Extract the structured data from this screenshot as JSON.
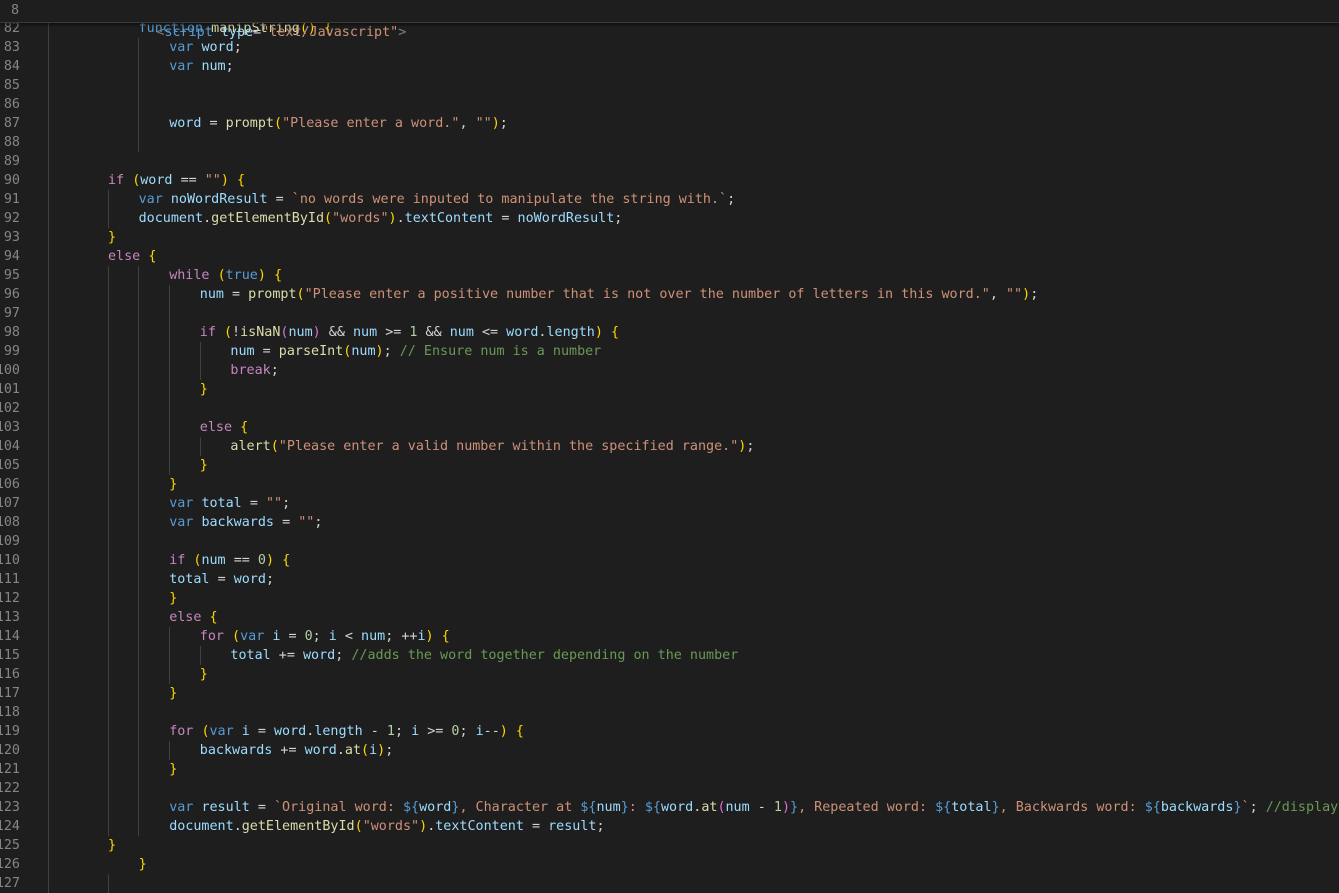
{
  "sticky": {
    "line_number": "8",
    "text": "<script type=\"text/Javascript\">"
  },
  "lines": [
    {
      "n": "82",
      "text": "    function manipString() {"
    },
    {
      "n": "83",
      "text": "        var word;"
    },
    {
      "n": "84",
      "text": "        var num;"
    },
    {
      "n": "85",
      "text": ""
    },
    {
      "n": "86",
      "text": ""
    },
    {
      "n": "87",
      "text": "        word = prompt(\"Please enter a word.\", \"\");"
    },
    {
      "n": "88",
      "text": ""
    },
    {
      "n": "89",
      "text": ""
    },
    {
      "n": "90",
      "text": "if (word == \"\") {"
    },
    {
      "n": "91",
      "text": "    var noWordResult = `no words were inputed to manipulate the string with.`;"
    },
    {
      "n": "92",
      "text": "    document.getElementById(\"words\").textContent = noWordResult;"
    },
    {
      "n": "93",
      "text": "}"
    },
    {
      "n": "94",
      "text": "else {"
    },
    {
      "n": "95",
      "text": "        while (true) {"
    },
    {
      "n": "96",
      "text": "            num = prompt(\"Please enter a positive number that is not over the number of letters in this word.\", \"\");"
    },
    {
      "n": "97",
      "text": ""
    },
    {
      "n": "98",
      "text": "            if (!isNaN(num) && num >= 1 && num <= word.length) {"
    },
    {
      "n": "99",
      "text": "                num = parseInt(num); // Ensure num is a number"
    },
    {
      "n": "100",
      "text": "                break;"
    },
    {
      "n": "101",
      "text": "            }"
    },
    {
      "n": "102",
      "text": ""
    },
    {
      "n": "103",
      "text": "            else {"
    },
    {
      "n": "104",
      "text": "                alert(\"Please enter a valid number within the specified range.\");"
    },
    {
      "n": "105",
      "text": "            }"
    },
    {
      "n": "106",
      "text": "        }"
    },
    {
      "n": "107",
      "text": "        var total = \"\";"
    },
    {
      "n": "108",
      "text": "        var backwards = \"\";"
    },
    {
      "n": "109",
      "text": ""
    },
    {
      "n": "110",
      "text": "        if (num == 0) {"
    },
    {
      "n": "111",
      "text": "        total = word;"
    },
    {
      "n": "112",
      "text": "        }"
    },
    {
      "n": "113",
      "text": "        else {"
    },
    {
      "n": "114",
      "text": "            for (var i = 0; i < num; ++i) {"
    },
    {
      "n": "115",
      "text": "                total += word; //adds the word together depending on the number"
    },
    {
      "n": "116",
      "text": "            }"
    },
    {
      "n": "117",
      "text": "        }"
    },
    {
      "n": "118",
      "text": ""
    },
    {
      "n": "119",
      "text": "        for (var i = word.length - 1; i >= 0; i--) {"
    },
    {
      "n": "120",
      "text": "            backwards += word.at(i);"
    },
    {
      "n": "121",
      "text": "        }"
    },
    {
      "n": "122",
      "text": ""
    },
    {
      "n": "123",
      "text": "        var result = `Original word: ${word}, Character at ${num}: ${word.at(num - 1)}, Repeated word: ${total}, Backwards word: ${backwards}`; //displays the c"
    },
    {
      "n": "124",
      "text": "        document.getElementById(\"words\").textContent = result;"
    },
    {
      "n": "125",
      "text": "}"
    },
    {
      "n": "126",
      "text": "    }"
    },
    {
      "n": "127",
      "text": ""
    }
  ],
  "colors": {
    "background": "#1e1e1e",
    "keyword": "#569cd6",
    "control": "#c586c0",
    "function": "#dcdcaa",
    "variable": "#9cdcfe",
    "string": "#ce9178",
    "number": "#b5cea8",
    "comment": "#6a9955"
  }
}
